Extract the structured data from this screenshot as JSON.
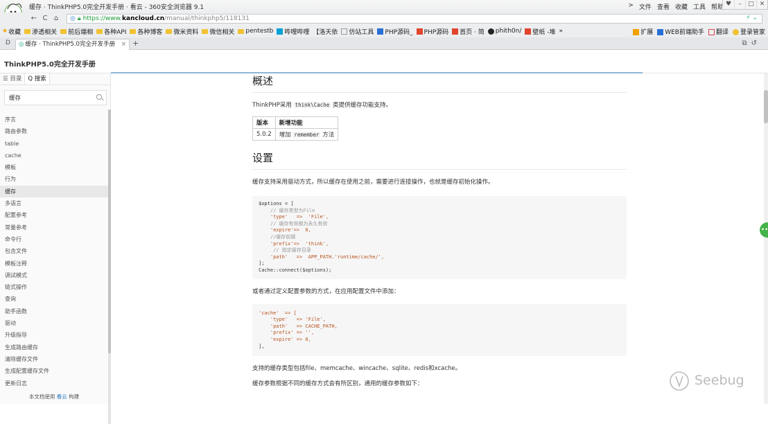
{
  "browser": {
    "window_title": "缓存 · ThinkPHP5.0完全开发手册 · 看云 - 360安全浏览器 9.1",
    "menu": [
      "文件",
      "查看",
      "收藏",
      "工具",
      "帮助"
    ],
    "address": {
      "scheme": "https://www.",
      "host": "kancloud.cn",
      "path": "/manual/thinkphp5/118131"
    },
    "bookmarks": [
      "收藏",
      "渗透相关",
      "前后端相",
      "各种API",
      "各种博客",
      "微米资料",
      "微信相关",
      "pentestb",
      "哔哩哔哩",
      "【洛天依",
      "仿站工具",
      "PHP源码_",
      "PHP源码",
      "首页 · 简",
      "phith0n/",
      "壁纸 -堆"
    ],
    "bookmarks_more": "»",
    "bookmark_tools": [
      "扩展",
      "WEB前端助手",
      "翻译",
      "登录管家"
    ],
    "tab": {
      "label": "缓存 · ThinkPHP5.0完全开发手册",
      "close": "×",
      "new": "+"
    },
    "colors": {
      "accent": "#2b7bc3",
      "https": "#1d9b3a"
    }
  },
  "page": {
    "site_title": "ThinkPHP5.0完全开发手册",
    "sidebar": {
      "tabs": [
        "☰ 目录",
        "Q 搜索"
      ],
      "search_value": "缓存",
      "items": [
        "序言",
        "路由参数",
        "table",
        "cache",
        "模板",
        "行为",
        "缓存",
        "多语言",
        "配置参考",
        "常量参考",
        "命令行",
        "包含文件",
        "模板注释",
        "调试模式",
        "链式操作",
        "查询",
        "助手函数",
        "驱动",
        "升级指导",
        "生成路由缓存",
        "清除缓存文件",
        "生成配置缓存文件",
        "更新日志"
      ],
      "active_index": 6,
      "footer_prefix": "本文档使用",
      "footer_link": "看云",
      "footer_suffix": "构建"
    },
    "content": {
      "h_overview": "概述",
      "intro_pre": "ThinkPHP采用",
      "intro_code": "think\\Cache",
      "intro_post": "类提供缓存功能支持。",
      "table": {
        "headers": [
          "版本",
          "新增功能"
        ],
        "rows": [
          [
            "5.0.2",
            "增加",
            "remember",
            "方法"
          ]
        ]
      },
      "h_settings": "设置",
      "settings_text": "缓存支持采用驱动方式，所以缓存在使用之前，需要进行连接操作，也就是缓存初始化操作。",
      "code1": [
        "$options = [",
        "    // 缓存类型为File",
        "    'type'   =>  'File',",
        "    // 缓存有效期为永久有效",
        "    'expire'=>  0,",
        "    //缓存前缀",
        "    'prefix'=>  'think',",
        "     // 指定缓存目录",
        "    'path'   =>  APP_PATH.'runtime/cache/',",
        "];",
        "Cache::connect($options);"
      ],
      "alt_text": "或者通过定义配置参数的方式，在应用配置文件中添加：",
      "code2": [
        "'cache'  => [",
        "    'type'   => 'File',",
        "    'path'   => CACHE_PATH,",
        "    'prefix' => '',",
        "    'expire' => 0,",
        "],"
      ],
      "supported_text": "支持的缓存类型包括file、memcache、wincache、sqlite、redis和xcache。",
      "params_text": "缓存参数根据不同的缓存方式会有所区别，通用的缓存参数如下："
    },
    "watermark": "Seebug"
  }
}
